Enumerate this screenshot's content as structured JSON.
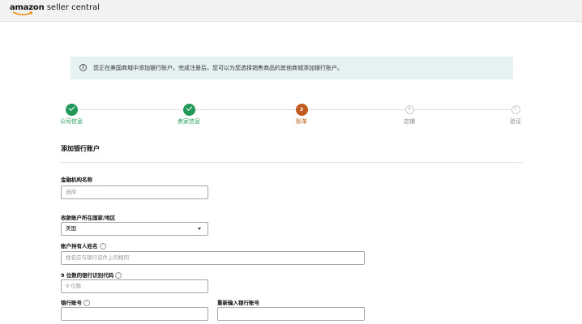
{
  "header": {
    "brand": "amazon",
    "product": " seller central"
  },
  "banner": {
    "icon": "info-icon",
    "text": "您正在美国商城中添加银行账户。完成注册后，您可以为您选择销售商品的其他商城添加银行账户。"
  },
  "stepper": {
    "steps": [
      {
        "label": "公司信息",
        "status": "done",
        "number": ""
      },
      {
        "label": "卖家信息",
        "status": "done",
        "number": ""
      },
      {
        "label": "账单",
        "status": "current",
        "number": "3"
      },
      {
        "label": "店铺",
        "status": "pending",
        "number": "4"
      },
      {
        "label": "验证",
        "status": "pending",
        "number": "5"
      }
    ]
  },
  "form": {
    "section_title": "添加银行账户",
    "institution": {
      "label": "金融机构名称",
      "placeholder": "选择"
    },
    "country": {
      "label": "收款账户所在国家/地区",
      "value": "美国"
    },
    "holder": {
      "label": "账户持有人姓名",
      "placeholder": "姓名应与银行证件上的相同"
    },
    "routing": {
      "label": "9 位数的银行识别代码",
      "placeholder": "9 位数"
    },
    "account": {
      "label": "银行账号",
      "placeholder": ""
    },
    "account_confirm": {
      "label": "重新输入银行账号",
      "placeholder": ""
    }
  }
}
